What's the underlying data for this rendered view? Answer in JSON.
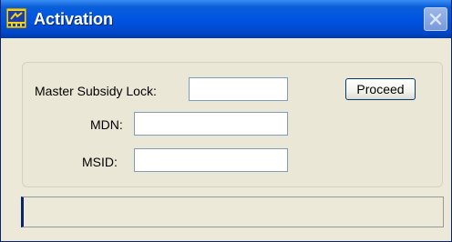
{
  "window": {
    "title": "Activation",
    "icon": "app-icon",
    "close_icon": "close-icon"
  },
  "form": {
    "master_subsidy_lock_label": "Master Subsidy Lock:",
    "master_subsidy_lock_value": "",
    "mdn_label": "MDN:",
    "mdn_value": "",
    "msid_label": "MSID:",
    "msid_value": ""
  },
  "actions": {
    "proceed_label": "Proceed"
  },
  "status_bar": {
    "text": ""
  },
  "colors": {
    "titlebar": "#0054e3",
    "window_background": "#ece9d8",
    "input_border": "#7f9db9",
    "status_accent": "#0a246a"
  }
}
